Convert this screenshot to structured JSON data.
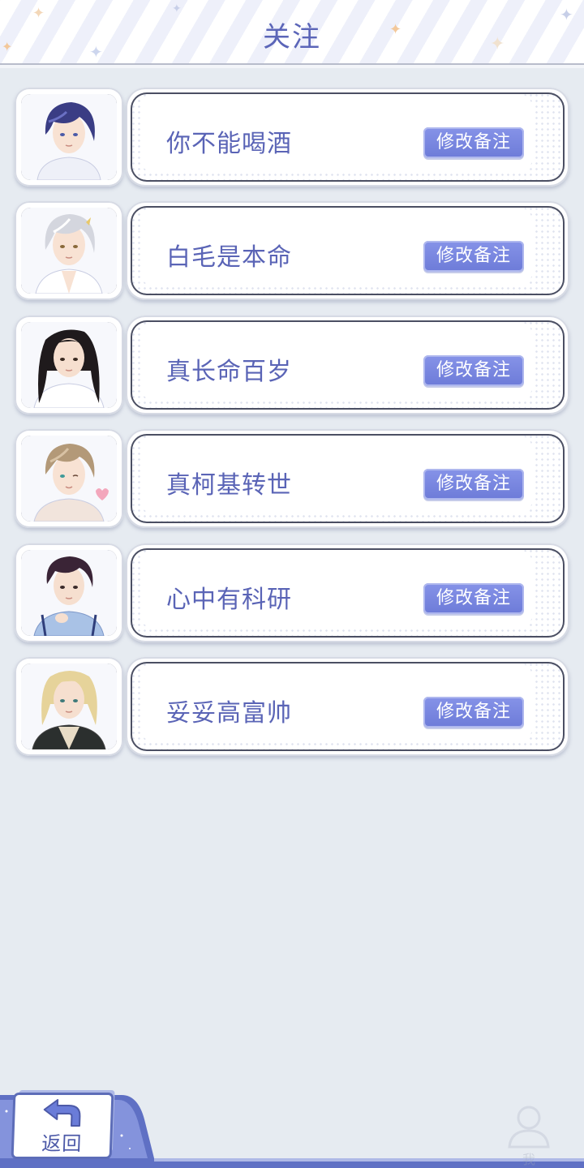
{
  "header": {
    "title": "关注"
  },
  "follow_list": [
    {
      "nickname": "你不能喝酒",
      "button_label": "修改备注",
      "avatar": "avatar-dark-blue-hair"
    },
    {
      "nickname": "白毛是本命",
      "button_label": "修改备注",
      "avatar": "avatar-white-hair"
    },
    {
      "nickname": "真长命百岁",
      "button_label": "修改备注",
      "avatar": "avatar-long-black-hair"
    },
    {
      "nickname": "真柯基转世",
      "button_label": "修改备注",
      "avatar": "avatar-light-brown-hair"
    },
    {
      "nickname": "心中有科研",
      "button_label": "修改备注",
      "avatar": "avatar-dark-purple-hair"
    },
    {
      "nickname": "妥妥高富帅",
      "button_label": "修改备注",
      "avatar": "avatar-blonde-hair"
    }
  ],
  "bottom_nav": {
    "back_label": "返回",
    "me_label": "我"
  },
  "colors": {
    "accent": "#5b65b8",
    "button": "#7b88e0",
    "background": "#e6ebf1"
  }
}
